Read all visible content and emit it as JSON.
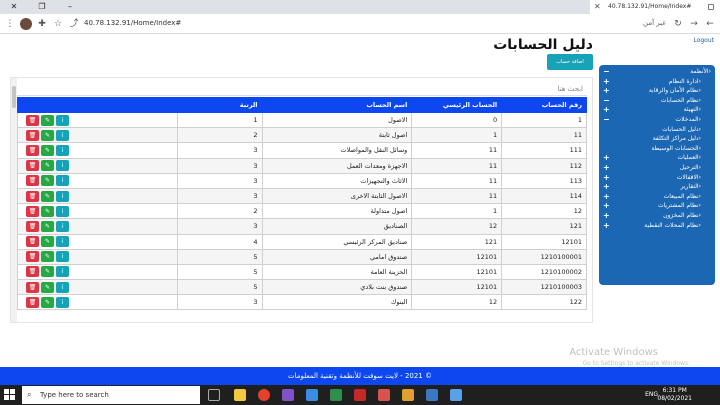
{
  "browser": {
    "tab_title": "40.78.132.91/Home/Index#",
    "url": "40.78.132.91/Home/Index#",
    "insecure_label": "غير آمن"
  },
  "header": {
    "logout": "Logout",
    "page_title": "دليل الحسابات",
    "add_button": "اضافة حساب"
  },
  "sidebar": {
    "items": [
      {
        "label": "الأنظمة",
        "sub": false,
        "plus": "minus"
      },
      {
        "label": "ادارة النظام",
        "sub": true,
        "plus": "plus"
      },
      {
        "label": "نظام الأمان والرقابة",
        "sub": true,
        "plus": "plus"
      },
      {
        "label": "نظام الحسابات",
        "sub": true,
        "plus": "minus"
      },
      {
        "label": "التهيئة",
        "sub": true,
        "plus": "plus"
      },
      {
        "label": "المدخلات",
        "sub": true,
        "plus": "minus"
      },
      {
        "label": "دليل الحسابات",
        "sub": true,
        "plus": ""
      },
      {
        "label": "دليل مراكز التكلفة",
        "sub": true,
        "plus": ""
      },
      {
        "label": "الحسابات الوسيطة",
        "sub": true,
        "plus": ""
      },
      {
        "label": "العمليات",
        "sub": true,
        "plus": "plus"
      },
      {
        "label": "الترحيل",
        "sub": true,
        "plus": "plus"
      },
      {
        "label": "الاقفالات",
        "sub": true,
        "plus": "plus"
      },
      {
        "label": "التقارير",
        "sub": true,
        "plus": "plus"
      },
      {
        "label": "نظام المبيعات",
        "sub": true,
        "plus": "plus"
      },
      {
        "label": "نظام المشتريات",
        "sub": true,
        "plus": "plus"
      },
      {
        "label": "نظام المخزون",
        "sub": true,
        "plus": "plus"
      },
      {
        "label": "نظام المحلات النقطية",
        "sub": true,
        "plus": "plus"
      }
    ]
  },
  "search": {
    "placeholder": "ابحث هنا"
  },
  "table": {
    "headers": [
      "رقم الحساب",
      "الحساب الرئيسي",
      "اسم الحساب",
      "الرتبة",
      ""
    ],
    "rows": [
      [
        "1",
        "0",
        "الاصول",
        "1"
      ],
      [
        "11",
        "1",
        "اصول ثابتة",
        "2"
      ],
      [
        "111",
        "11",
        "وسائل النقل والمواصلات",
        "3"
      ],
      [
        "112",
        "11",
        "الاجهزة ومعدات العمل",
        "3"
      ],
      [
        "113",
        "11",
        "الاثاث والتجهيزات",
        "3"
      ],
      [
        "114",
        "11",
        "الاصول الثابتة الاخرى",
        "3"
      ],
      [
        "12",
        "1",
        "اصول متداولة",
        "2"
      ],
      [
        "121",
        "12",
        "الصناديق",
        "3"
      ],
      [
        "12101",
        "121",
        "صناديق المركز الرئيسي",
        "4"
      ],
      [
        "1210100001",
        "12101",
        "صندوق امامي",
        "5"
      ],
      [
        "1210100002",
        "12101",
        "الخزينة العامة",
        "5"
      ],
      [
        "1210100003",
        "12101",
        "صندوق بنت بلادي",
        "5"
      ],
      [
        "122",
        "12",
        "البنوك",
        "3"
      ]
    ]
  },
  "watermark": {
    "line1": "Activate Windows",
    "line2": "Go to Settings to activate Windows."
  },
  "footer": {
    "text": "© 2021 - لايت سوفت للأنظمة وتقنية المعلومات"
  },
  "taskbar": {
    "search_placeholder": "Type here to search",
    "lang": "ENG",
    "time": "6:31 PM",
    "date": "08/02/2021"
  },
  "colors": {
    "table_header": "#0d47f0",
    "sidebar": "#1c67b3",
    "add_button": "#17a2b8",
    "btn_info": "#17a2b8",
    "btn_edit": "#28a745",
    "btn_delete": "#dc3545"
  }
}
